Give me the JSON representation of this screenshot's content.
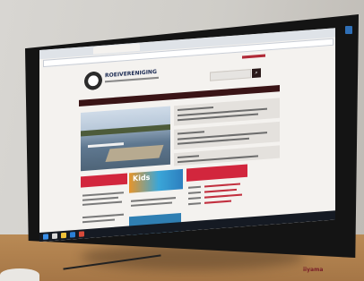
{
  "scene": {
    "monitor_brand": "iiyama",
    "screen": {
      "site_name": "ROEIVERENIGING",
      "search_button_icon": "search-icon",
      "kids_banner_text": "Kids"
    }
  },
  "colors": {
    "nav": "#3a1416",
    "accent_red": "#d2263d",
    "blue_tile": "#2f7fb3",
    "taskbar": "#151a23"
  }
}
